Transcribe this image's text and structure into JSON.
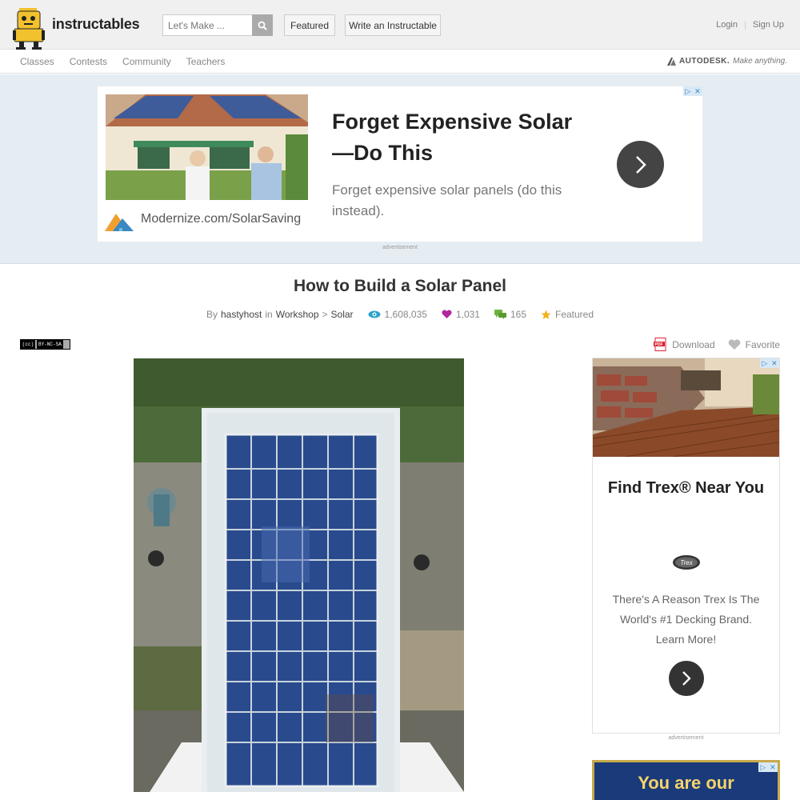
{
  "header": {
    "logo_text": "instructables",
    "search_placeholder": "Let's Make ...",
    "featured_label": "Featured",
    "write_label": "Write an Instructable",
    "login_label": "Login",
    "signup_label": "Sign Up"
  },
  "nav": {
    "items": [
      "Classes",
      "Contests",
      "Community",
      "Teachers"
    ],
    "autodesk_brand": "AUTODESK.",
    "autodesk_tagline": "Make anything."
  },
  "top_ad": {
    "title": "Forget Expensive Solar—Do This",
    "description": "Forget expensive solar panels (do this instead).",
    "url": "Modernize.com/SolarSaving",
    "label": "advertisement"
  },
  "article": {
    "title": "How to Build a Solar Panel",
    "by_label": "By",
    "author": "hastyhost",
    "in_label": "in",
    "category": "Workshop",
    "separator": ">",
    "subcategory": "Solar",
    "views": "1,608,035",
    "favorites": "1,031",
    "comments": "165",
    "featured": "Featured",
    "license_text": "BY-NC-SA",
    "download_label": "Download",
    "favorite_label": "Favorite"
  },
  "side_ad": {
    "title": "Find Trex® Near You",
    "description": "There's A Reason Trex Is The World's #1 Decking Brand. Learn More!",
    "label": "advertisement",
    "ad2_text": "You are our"
  },
  "colors": {
    "views_icon": "#2ba3c7",
    "favorites_icon": "#b0279e",
    "comments_icon": "#6db33f",
    "featured_icon": "#f0b41c",
    "ad_band": "#e5edf3"
  }
}
